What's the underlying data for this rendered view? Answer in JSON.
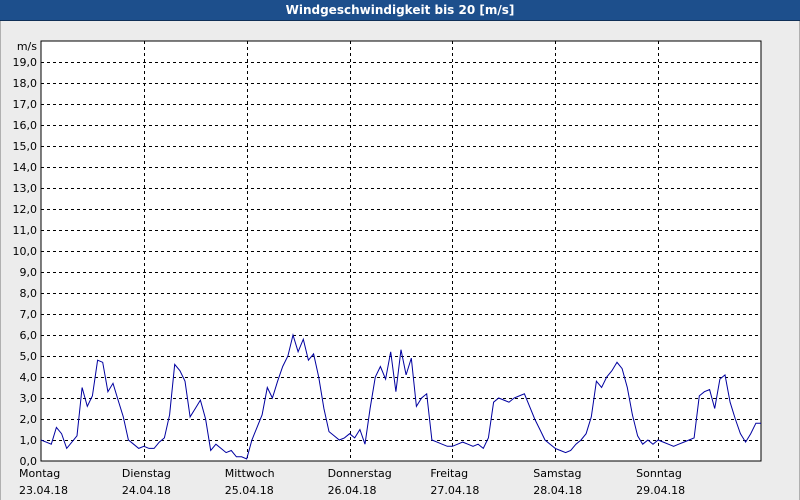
{
  "window": {
    "title": "Windgeschwindigkeit bis 20 [m/s]"
  },
  "colors": {
    "title_bar": "#1d4f8c",
    "line": "#0000a0",
    "grid": "#000000",
    "background": "#ffffff"
  },
  "chart_data": {
    "type": "line",
    "title": "Windgeschwindigkeit bis 20 [m/s]",
    "ylabel": "m/s",
    "xlabel": "",
    "ylim": [
      0,
      20
    ],
    "xlim": [
      0,
      7
    ],
    "grid": true,
    "y_ticks": [
      "0,0",
      "1,0",
      "2,0",
      "3,0",
      "4,0",
      "5,0",
      "6,0",
      "7,0",
      "8,0",
      "9,0",
      "10,0",
      "11,0",
      "12,0",
      "13,0",
      "14,0",
      "15,0",
      "16,0",
      "17,0",
      "18,0",
      "19,0"
    ],
    "x_ticks": [
      {
        "day": "Montag",
        "date": "23.04.18"
      },
      {
        "day": "Dienstag",
        "date": "24.04.18"
      },
      {
        "day": "Mittwoch",
        "date": "25.04.18"
      },
      {
        "day": "Donnerstag",
        "date": "26.04.18"
      },
      {
        "day": "Freitag",
        "date": "27.04.18"
      },
      {
        "day": "Samstag",
        "date": "28.04.18"
      },
      {
        "day": "Sonntag",
        "date": "29.04.18"
      }
    ],
    "series": [
      {
        "x": [
          0.0,
          0.05,
          0.1,
          0.15,
          0.2,
          0.25,
          0.3,
          0.35,
          0.4,
          0.45,
          0.5,
          0.55,
          0.6,
          0.65,
          0.7,
          0.75,
          0.8,
          0.85,
          0.9,
          0.95,
          1.0,
          1.05,
          1.1,
          1.15,
          1.2,
          1.25,
          1.3,
          1.35,
          1.4,
          1.45,
          1.5,
          1.55,
          1.6,
          1.65,
          1.7,
          1.75,
          1.8,
          1.85,
          1.9,
          1.95,
          2.0,
          2.05,
          2.1,
          2.15,
          2.2,
          2.25,
          2.3,
          2.35,
          2.4,
          2.45,
          2.5,
          2.55,
          2.6,
          2.65,
          2.7,
          2.75,
          2.8,
          2.85,
          2.9,
          2.95,
          3.0,
          3.05,
          3.1,
          3.15,
          3.2,
          3.25,
          3.3,
          3.35,
          3.4,
          3.45,
          3.5,
          3.55,
          3.6,
          3.65,
          3.7,
          3.75,
          3.8,
          3.85,
          3.9,
          3.95,
          4.0,
          4.05,
          4.1,
          4.15,
          4.2,
          4.25,
          4.3,
          4.35,
          4.4,
          4.45,
          4.5,
          4.55,
          4.6,
          4.65,
          4.7,
          4.75,
          4.8,
          4.85,
          4.9,
          4.95,
          5.0,
          5.05,
          5.1,
          5.15,
          5.2,
          5.25,
          5.3,
          5.35,
          5.4,
          5.45,
          5.5,
          5.55,
          5.6,
          5.65,
          5.7,
          5.75,
          5.8,
          5.85,
          5.9,
          5.95,
          6.0,
          6.05,
          6.1,
          6.15,
          6.2,
          6.25,
          6.3,
          6.35,
          6.4,
          6.45,
          6.5,
          6.55,
          6.6,
          6.65,
          6.7,
          6.75,
          6.8,
          6.85,
          6.9,
          6.95,
          7.0
        ],
        "y": [
          1.0,
          0.9,
          0.8,
          1.6,
          1.3,
          0.6,
          0.9,
          1.2,
          3.5,
          2.6,
          3.1,
          4.8,
          4.7,
          3.3,
          3.7,
          2.9,
          2.1,
          1.0,
          0.8,
          0.6,
          0.7,
          0.6,
          0.6,
          0.9,
          1.1,
          2.2,
          4.6,
          4.3,
          3.8,
          2.1,
          2.5,
          2.9,
          2.0,
          0.5,
          0.8,
          0.6,
          0.4,
          0.5,
          0.2,
          0.2,
          0.1,
          1.0,
          1.6,
          2.2,
          3.5,
          3.0,
          3.8,
          4.5,
          5.0,
          6.0,
          5.2,
          5.8,
          4.8,
          5.1,
          4.0,
          2.5,
          1.4,
          1.2,
          1.0,
          1.1,
          1.3,
          1.1,
          1.5,
          0.8,
          2.5,
          4.0,
          4.5,
          3.9,
          5.2,
          3.3,
          5.3,
          4.1,
          4.9,
          2.6,
          3.0,
          3.2,
          1.0,
          0.9,
          0.8,
          0.7,
          0.7,
          0.8,
          0.9,
          0.8,
          0.7,
          0.8,
          0.6,
          1.1,
          2.8,
          3.0,
          2.9,
          2.8,
          3.0,
          3.1,
          3.2,
          2.6,
          2.0,
          1.5,
          1.0,
          0.8,
          0.6,
          0.5,
          0.4,
          0.5,
          0.8,
          1.0,
          1.3,
          2.1,
          3.8,
          3.5,
          4.0,
          4.3,
          4.7,
          4.4,
          3.5,
          2.2,
          1.2,
          0.8,
          1.0,
          0.8,
          1.0,
          0.9,
          0.8,
          0.7,
          0.8,
          0.9,
          1.0,
          1.1,
          3.1,
          3.3,
          3.4,
          2.5,
          3.9,
          4.1,
          2.8,
          2.0,
          1.3,
          0.9,
          1.3,
          1.8,
          1.8
        ]
      }
    ]
  }
}
